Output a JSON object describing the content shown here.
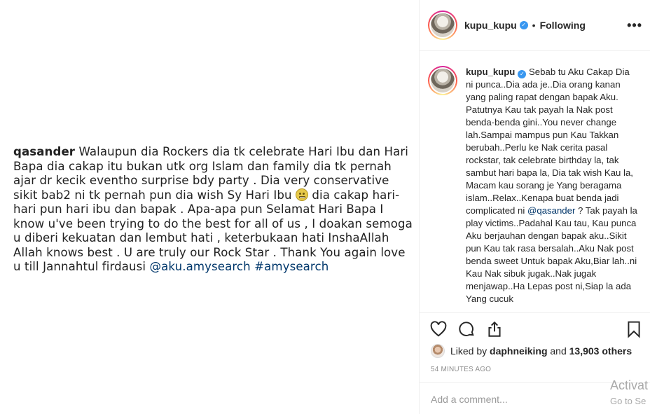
{
  "image_caption": {
    "username": "qasander",
    "text_before_emoji": "Walaupun dia Rockers dia tk celebrate Hari Ibu dan Hari Bapa dia cakap itu bukan utk org Islam dan family dia tk pernah ajar dr kecik eventho surprise bdy party . Dia very conservative sikit bab2 ni tk pernah pun dia wish Sy Hari Ibu",
    "emoji": "grimacing-face",
    "text_after_emoji": "dia cakap hari-hari pun hari ibu dan bapak . Apa-apa pun Selamat Hari Bapa I know u've been trying to do the best for all of us , I doakan semoga u diberi kekuatan dan lembut hati ,  keterbukaan hati InshaAllah Allah knows best . U are truly our Rock Star . Thank You again love u till Jannahtul firdausi",
    "mention": "@aku.amysearch",
    "hashtag": "#amysearch"
  },
  "header": {
    "username": "kupu_kupu",
    "separator": "•",
    "follow_status": "Following",
    "more_label": "•••"
  },
  "comment": {
    "username": "kupu_kupu",
    "text_before_mention": "Sebab tu Aku Cakap Dia ni punca..Dia ada je..Dia orang kanan yang paling rapat dengan bapak Aku. Patutnya Kau tak payah la Nak post benda-benda gini..You never change lah.Sampai mampus pun Kau Takkan berubah..Perlu ke Nak cerita pasal rockstar, tak celebrate birthday la, tak sambut hari bapa la, Dia tak wish Kau la, Macam kau sorang je Yang beragama islam..Relax..Kenapa buat benda jadi complicated ni",
    "mention": "@qasander",
    "text_after_mention": "? Tak payah la play victims..Padahal Kau tau, Kau punca Aku berjauhan dengan bapak aku..Sikit pun Kau tak rasa bersalah..Aku Nak post benda sweet Untuk bapak Aku,Biar lah..ni Kau Nak sibuk jugak..Nak jugak menjawap..Ha Lepas post ni,Siap la ada Yang cucuk"
  },
  "likes": {
    "prefix": "Liked by",
    "liker": "daphneiking",
    "and": "and",
    "others": "13,903 others"
  },
  "timestamp": "54 MINUTES AGO",
  "add_comment_placeholder": "Add a comment...",
  "watermark": {
    "line1": "Activat",
    "line2": "Go to Se"
  },
  "icons": [
    "heart-icon",
    "comment-icon",
    "share-icon",
    "bookmark-icon",
    "verified-icon",
    "more-icon"
  ]
}
